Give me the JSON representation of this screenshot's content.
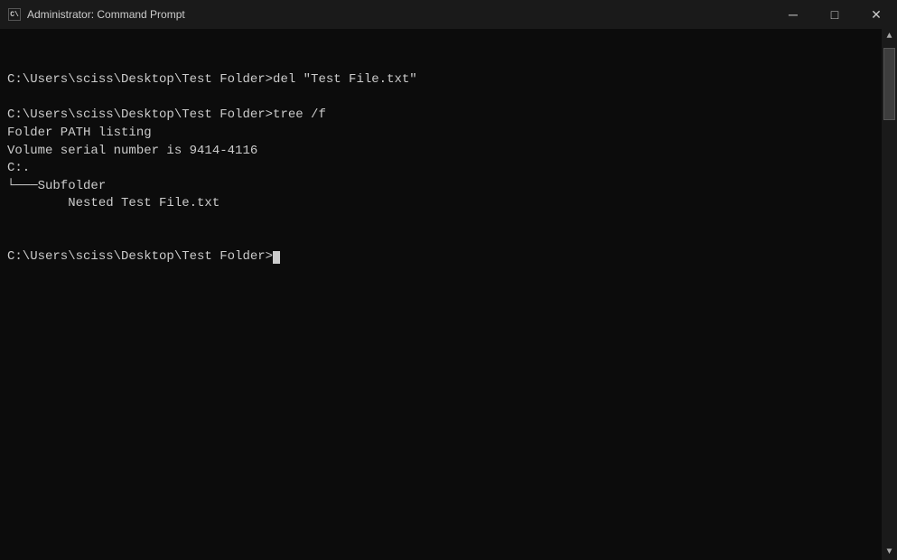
{
  "titleBar": {
    "title": "Administrator: Command Prompt",
    "icon": "C:\\",
    "minimizeLabel": "─",
    "maximizeLabel": "□",
    "closeLabel": "✕"
  },
  "terminal": {
    "lines": [
      "",
      "C:\\Users\\sciss\\Desktop\\Test Folder>del \"Test File.txt\"",
      "",
      "C:\\Users\\sciss\\Desktop\\Test Folder>tree /f",
      "Folder PATH listing",
      "Volume serial number is 9414-4116",
      "C:.",
      "└───Subfolder",
      "        Nested Test File.txt",
      "",
      "",
      "C:\\Users\\sciss\\Desktop\\Test Folder>"
    ],
    "prompt": "C:\\Users\\sciss\\Desktop\\Test Folder>"
  }
}
